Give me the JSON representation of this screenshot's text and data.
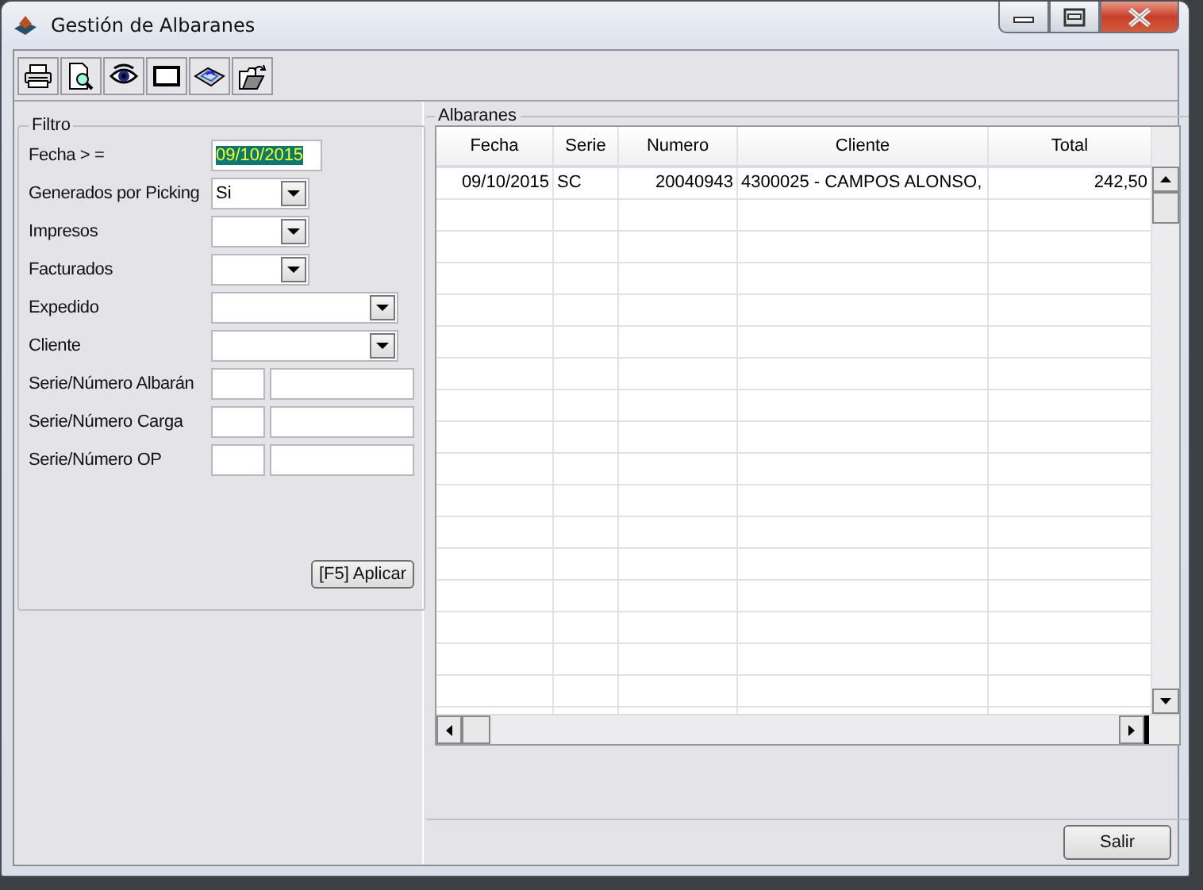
{
  "window": {
    "title": "Gestión de Albaranes"
  },
  "toolbar": [
    {
      "kind": "print"
    },
    {
      "kind": "preview"
    },
    {
      "kind": "view"
    },
    {
      "kind": "window"
    },
    {
      "kind": "tray"
    },
    {
      "kind": "export"
    }
  ],
  "filter": {
    "title": "Filtro",
    "fields": [
      {
        "label": "Fecha > =",
        "kind": "date",
        "value": "09/10/2015",
        "highlighted": true
      },
      {
        "label": "Generados por Picking",
        "kind": "short-combo",
        "value": "Si"
      },
      {
        "label": "Impresos",
        "kind": "short-combo"
      },
      {
        "label": "Facturados",
        "kind": "short-combo"
      },
      {
        "label": "Expedido",
        "kind": "combo"
      },
      {
        "label": "Cliente",
        "kind": "combo"
      },
      {
        "label": "Serie/Número Albarán",
        "kind": "pair"
      },
      {
        "label": "Serie/Número Carga",
        "kind": "pair"
      },
      {
        "label": "Serie/Número OP",
        "kind": "pair"
      }
    ],
    "apply_button": "[F5] Aplicar"
  },
  "albaranes": {
    "title": "Albaranes",
    "table": {
      "columns": [
        "Fecha",
        "Serie",
        "Numero",
        "Cliente",
        "Total"
      ],
      "rows": [
        [
          "09/10/2015",
          "SC",
          "20040943",
          "4300025 - CAMPOS ALONSO,",
          "242,50"
        ]
      ]
    }
  },
  "buttons": [
    "Salir"
  ]
}
